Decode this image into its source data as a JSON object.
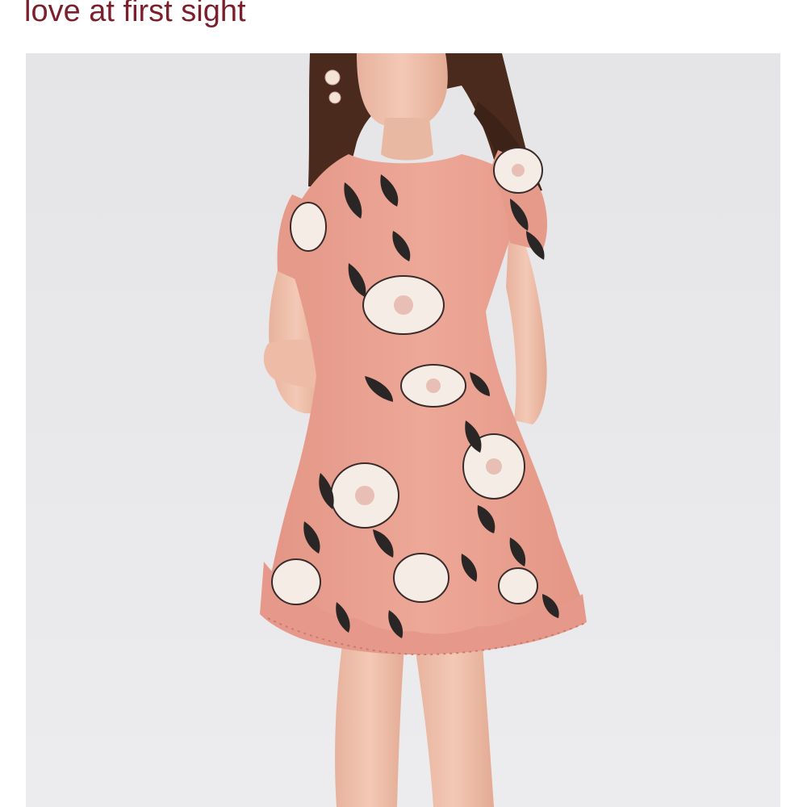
{
  "post": {
    "caption": "love at first sight",
    "photo_icon": "photo-icon"
  },
  "colors": {
    "caption_text": "#7a1f2b",
    "photo_background": "#e8e8ea",
    "dress": "#e9a293",
    "dress_shadow": "#d98f80",
    "flower_petal": "#f6ece6",
    "leaf": "#2b2626",
    "skin": "#f0c2ad",
    "hair": "#4a2a1d"
  }
}
